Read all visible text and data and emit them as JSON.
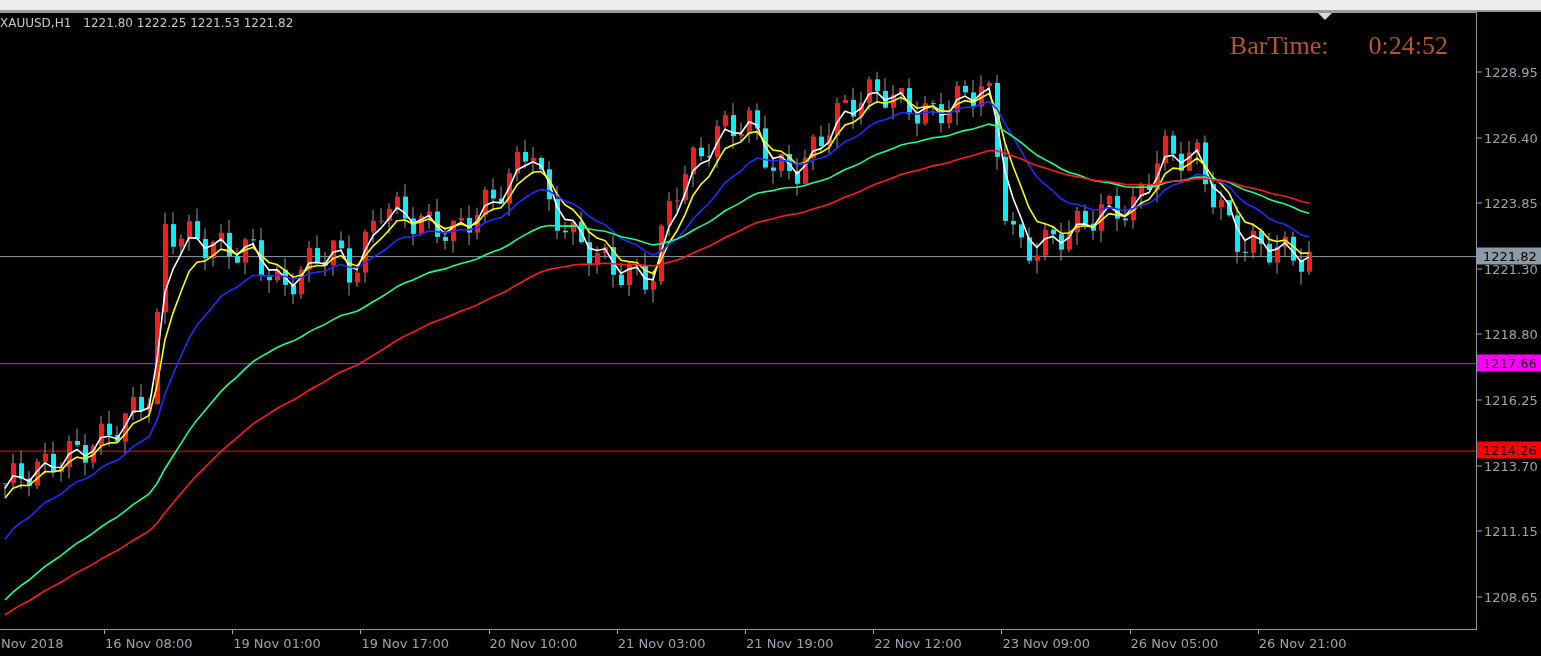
{
  "chart": {
    "symbol": "XAUUSD,H1",
    "quote": "1221.80 1222.25 1221.53 1221.82",
    "bar_time_label": "BarTime:",
    "bar_time_value": "0:24:52"
  },
  "price_axis": {
    "ticks": [
      "1228.95",
      "1226.40",
      "1223.85",
      "1221.30",
      "1218.80",
      "1216.25",
      "1213.70",
      "1211.15",
      "1208.65"
    ],
    "levels": [
      {
        "price": "1221.82",
        "color": "#8c9aa6"
      },
      {
        "price": "1217.66",
        "color": "#ff00ff"
      },
      {
        "price": "1214.26",
        "color": "#ff0000"
      }
    ]
  },
  "time_axis": {
    "labels": [
      "Nov 2018",
      "16 Nov 08:00",
      "19 Nov 01:00",
      "19 Nov 17:00",
      "20 Nov 10:00",
      "21 Nov 03:00",
      "21 Nov 19:00",
      "22 Nov 12:00",
      "23 Nov 09:00",
      "26 Nov 05:00",
      "26 Nov 21:00"
    ]
  }
}
